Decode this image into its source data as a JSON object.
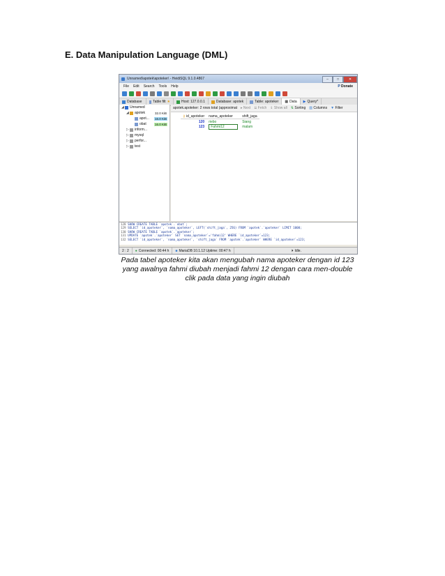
{
  "document": {
    "heading": "E.  Data Manipulation Language (DML)",
    "caption_lines": [
      "Pada tabel apoteker kita akan mengubah nama apoteker dengan id 123",
      "yang awalnya fahmi diubah menjadi fahmi 12 dengan cara men-double",
      "clik pada data yang ingin diubah"
    ]
  },
  "app": {
    "title": "Unnamed\\apotek\\apoteker\\ - HeidiSQL 9.1.0.4867",
    "window_buttons": [
      "–",
      "□",
      "✕"
    ],
    "menu": [
      "File",
      "Edit",
      "Search",
      "Tools",
      "Help"
    ],
    "donate_label": "Donate",
    "toolbar_icon_colors": [
      "#3a7fd0",
      "#2f9b43",
      "#d04a3a",
      "#3a7fd0",
      "#7a7a7a",
      "#3a7fd0",
      "#888888",
      "#2f9b43",
      "#3a7fd0",
      "#d04a3a",
      "#2f9b43",
      "#d04a3a",
      "#e0a020",
      "#2f9b43",
      "#d04a3a",
      "#3a7fd0",
      "#3a7fd0",
      "#7a7a7a",
      "#7a7a7a",
      "#3a7fd0",
      "#2f9b43",
      "#e0a020",
      "#3a7fd0",
      "#d04a3a"
    ],
    "left_tabs": [
      "Database",
      "Table filt"
    ],
    "main_tabs": [
      {
        "label": "Host: 127.0.0.1",
        "active": false
      },
      {
        "label": "Database: apotek",
        "active": false
      },
      {
        "label": "Table: apoteker",
        "active": false
      },
      {
        "label": "Data",
        "active": true
      },
      {
        "label": "Query*",
        "active": false
      }
    ],
    "tree": [
      {
        "label": "Unnamed",
        "size": "",
        "indent": 0,
        "expander": "◢",
        "color": "#2f6bd0",
        "highlight": ""
      },
      {
        "label": "apotek",
        "size": "32.0 KiB",
        "indent": 1,
        "expander": "◢",
        "color": "#e0a020",
        "highlight": ""
      },
      {
        "label": "apot...",
        "size": "16.0 KiB",
        "indent": 2,
        "expander": "",
        "color": "#7a9ad0",
        "highlight": "#9fd8f5"
      },
      {
        "label": "obat",
        "size": "16.0 KiB",
        "indent": 2,
        "expander": "",
        "color": "#7a9ad0",
        "highlight": "#b8f0a8"
      },
      {
        "label": "inform...",
        "size": "",
        "indent": 1,
        "expander": "▷",
        "color": "#9a9a9a",
        "highlight": ""
      },
      {
        "label": "mysql",
        "size": "",
        "indent": 1,
        "expander": "▷",
        "color": "#9a9a9a",
        "highlight": ""
      },
      {
        "label": "perfor...",
        "size": "",
        "indent": 1,
        "expander": "▷",
        "color": "#9a9a9a",
        "highlight": ""
      },
      {
        "label": "test",
        "size": "",
        "indent": 1,
        "expander": "▷",
        "color": "#9a9a9a",
        "highlight": ""
      }
    ],
    "data_toolbar": {
      "info": "apotek.apoteker: 2 rows total (approximat",
      "next": "Next",
      "fetch": "Fetch",
      "show_all": "Show all",
      "sorting": "Sorting",
      "columns": "Columns",
      "filter": "Filter"
    },
    "grid": {
      "columns": [
        "id_apoteker",
        "nama_apoteker",
        "shift_jaga"
      ],
      "rows": [
        {
          "id": "120",
          "nama": "riebo",
          "shift": "Siang",
          "editing": false
        },
        {
          "id": "123",
          "nama": "Fahmi12",
          "shift": "malam",
          "editing": true
        }
      ]
    },
    "log_lines": [
      {
        "n": "128",
        "text": "SHOW CREATE TABLE `apotek`.`obat`;"
      },
      {
        "n": "129",
        "text": "SELECT `id_apoteker`, `nama_apoteker`, LEFT(`shift_jaga`, 256) FROM `apotek`.`apoteker` LIMIT 1000;"
      },
      {
        "n": "130",
        "text": "SHOW CREATE TABLE `apotek`.`apoteker`;"
      },
      {
        "n": "131",
        "text": "UPDATE `apotek`.`apoteker` SET `nama_apoteker`='fahmi12' WHERE `id_apoteker`=123;"
      },
      {
        "n": "132",
        "text": "SELECT `id_apoteker`, `nama_apoteker`, `shift_jaga` FROM `apotek`.`apoteker` WHERE `id_apoteker`=123;"
      }
    ],
    "status": {
      "position": "2 : 2",
      "connected": "Connected: 00:44 h",
      "server": "MariaDB 10.1.12  Uptime: 00:47 h",
      "state": "Idle."
    }
  }
}
